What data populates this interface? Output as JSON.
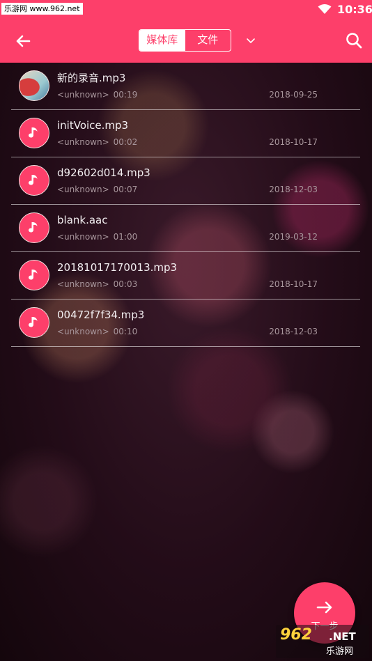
{
  "status_bar": {
    "watermark": "乐游网 www.962.net",
    "time": "10:36"
  },
  "app_bar": {
    "tabs": [
      {
        "label": "媒体库",
        "active": true
      },
      {
        "label": "文件",
        "active": false
      }
    ],
    "accent_color": "#fd3f6a"
  },
  "files": [
    {
      "name": "新的录音.mp3",
      "artist": "<unknown>",
      "duration": "00:19",
      "date": "2018-09-25",
      "thumb": "album-art"
    },
    {
      "name": "initVoice.mp3",
      "artist": "<unknown>",
      "duration": "00:02",
      "date": "2018-10-17",
      "thumb": "music-note-icon"
    },
    {
      "name": "d92602d014.mp3",
      "artist": "<unknown>",
      "duration": "00:07",
      "date": "2018-12-03",
      "thumb": "music-note-icon"
    },
    {
      "name": "blank.aac",
      "artist": "<unknown>",
      "duration": "01:00",
      "date": "2019-03-12",
      "thumb": "music-note-icon"
    },
    {
      "name": "20181017170013.mp3",
      "artist": "<unknown>",
      "duration": "00:03",
      "date": "2018-10-17",
      "thumb": "music-note-icon"
    },
    {
      "name": "00472f7f34.mp3",
      "artist": "<unknown>",
      "duration": "00:10",
      "date": "2018-12-03",
      "thumb": "music-note-icon"
    }
  ],
  "fab": {
    "label": "下一步"
  },
  "watermark_bottom": {
    "logo": "962",
    "net": ".NET",
    "sub": "乐游网"
  }
}
